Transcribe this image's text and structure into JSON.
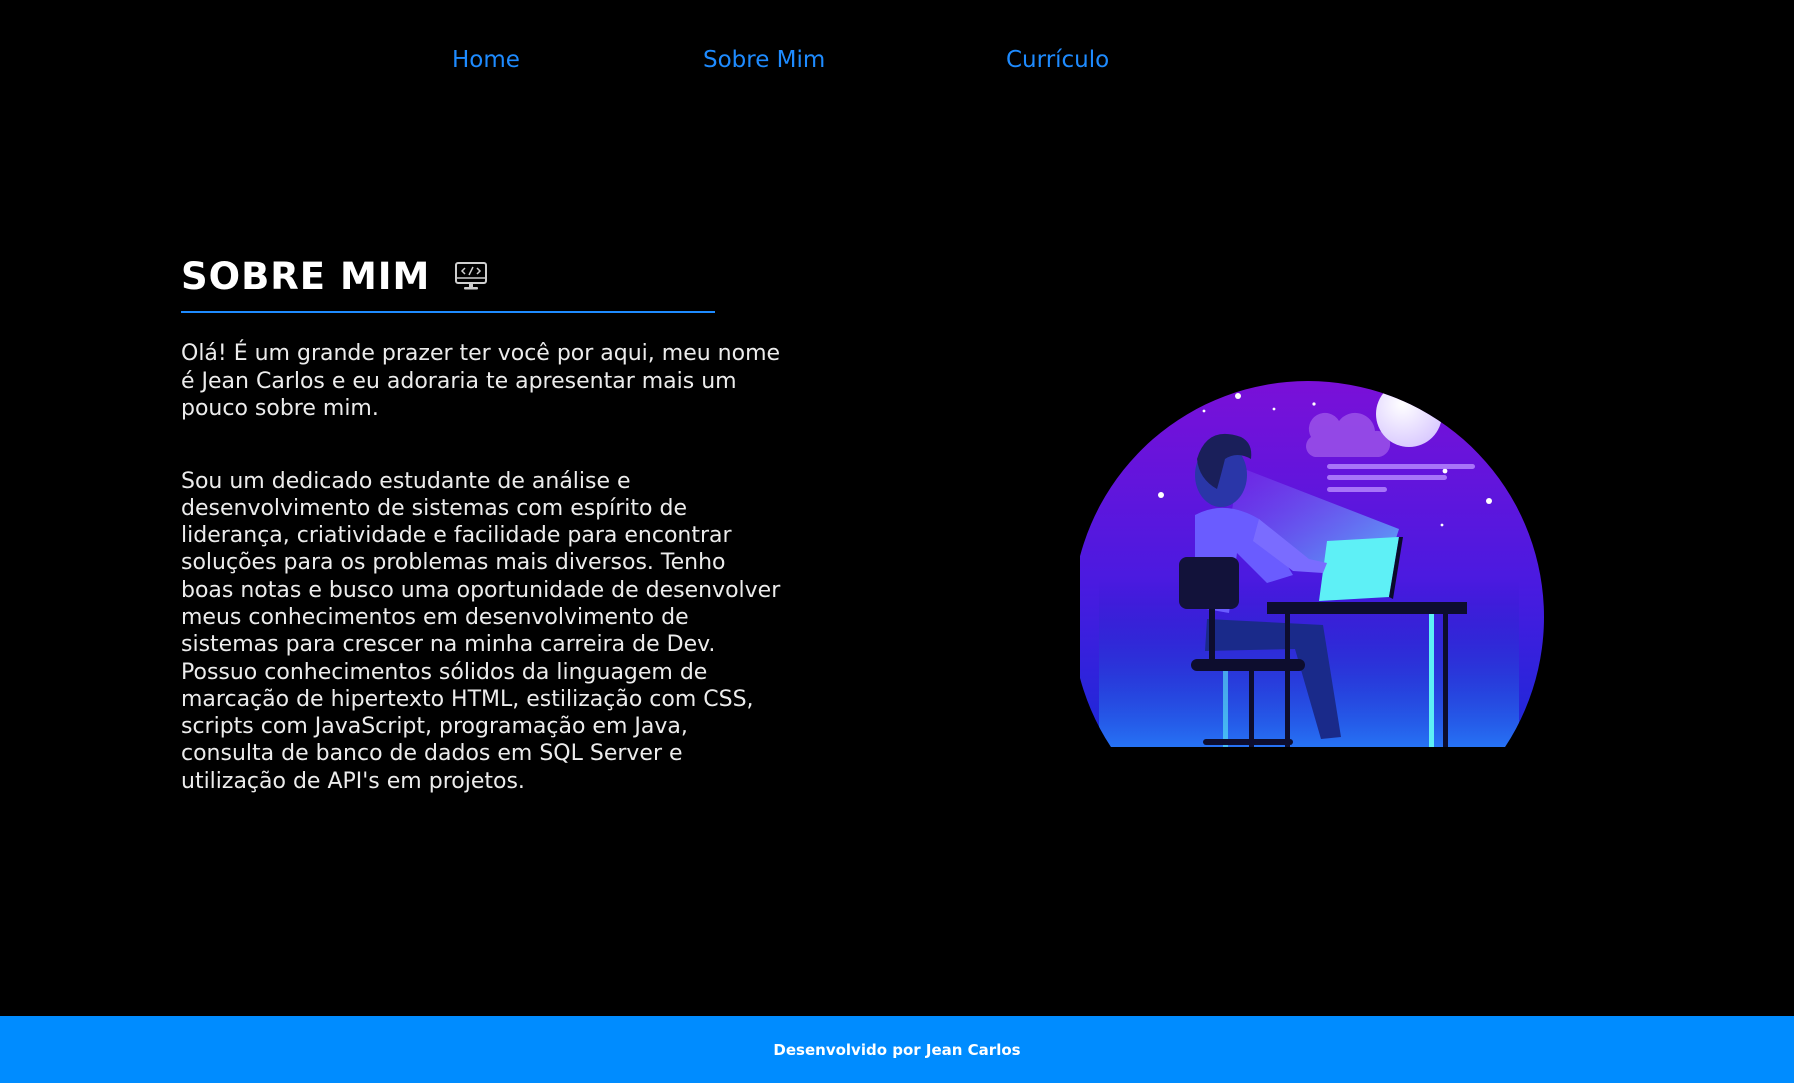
{
  "nav": {
    "items": [
      {
        "label": "Home"
      },
      {
        "label": "Sobre Mim"
      },
      {
        "label": "Currículo"
      }
    ]
  },
  "section": {
    "title": "SOBRE MIM",
    "title_icon": "monitor-code-icon",
    "intro": "Olá! É um grande prazer ter você por aqui, meu nome é Jean Carlos e eu adoraria te apresentar mais um pouco sobre mim.",
    "bio": "Sou um dedicado estudante de análise e desenvolvimento de sistemas com espírito de liderança, criatividade e facilidade para encontrar soluções para os problemas mais diversos. Tenho boas notas e busco uma oportunidade de desenvolver meus conhecimentos em desenvolvimento de sistemas para crescer na minha carreira de Dev. Possuo conhecimentos sólidos da linguagem de marcação de hipertexto HTML, estilização com CSS, scripts com JavaScript, programação em Java, consulta de banco de dados em SQL Server e utilização de API's em projetos."
  },
  "illustration": {
    "icon": "developer-at-desk-night-illustration"
  },
  "footer": {
    "text": "Desenvolvido por Jean Carlos"
  },
  "colors": {
    "background": "#000000",
    "accent": "#1e8bff",
    "footer": "#008cff",
    "text": "#ececec"
  }
}
